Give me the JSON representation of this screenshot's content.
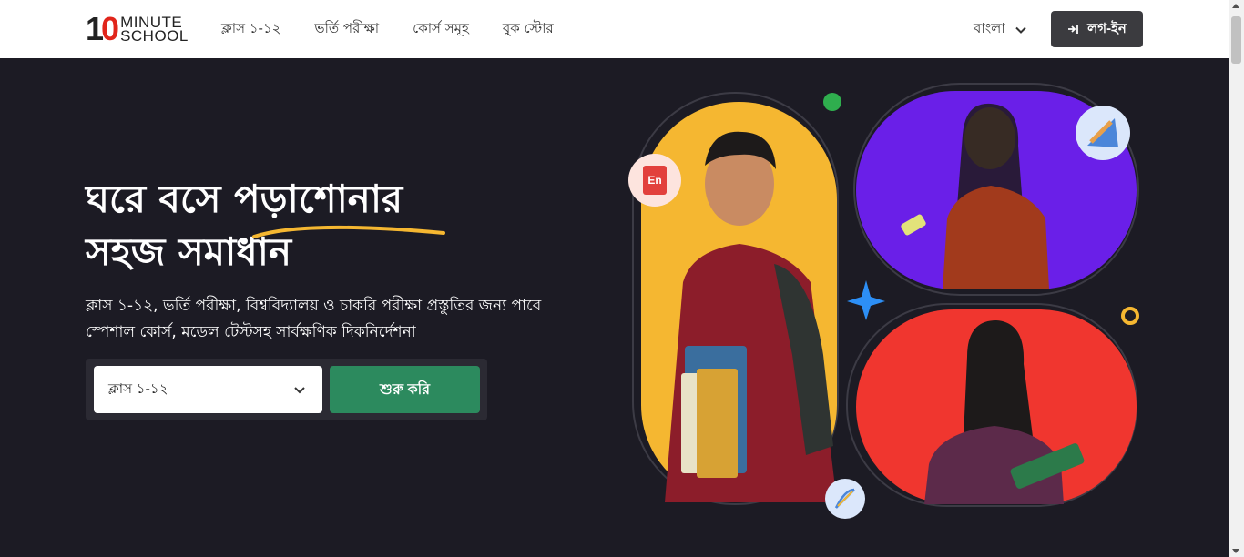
{
  "header": {
    "logo": {
      "number": "10",
      "line1": "MINUTE",
      "line2": "SCHOOL"
    },
    "nav": [
      {
        "label": "ক্লাস ১-১২"
      },
      {
        "label": "ভর্তি পরীক্ষা"
      },
      {
        "label": "কোর্স সমূহ"
      },
      {
        "label": "বুক স্টোর"
      }
    ],
    "language": "বাংলা",
    "login_label": "লগ-ইন"
  },
  "hero": {
    "title_line1": "ঘরে বসে পড়াশোনার",
    "title_line2": "সহজ সমাধান",
    "subtitle_line1": "ক্লাস ১-১২, ভর্তি পরীক্ষা, বিশ্ববিদ্যালয় ও চাকরি পরীক্ষা প্রস্তুতির জন্য পাবে",
    "subtitle_line2": "স্পেশাল কোর্স, মডেল টেস্টসহ সার্বক্ষণিক দিকনির্দেশনা",
    "select_value": "ক্লাস ১-১২",
    "start_label": "শুরু করি"
  },
  "illustration": {
    "badge_en": "En"
  },
  "colors": {
    "background": "#1c1b24",
    "accent_green": "#2c8a5e",
    "underline_yellow": "#f5b731",
    "panel_yellow": "#f5b731",
    "panel_purple": "#6a1fe8",
    "panel_red": "#f0362f"
  }
}
